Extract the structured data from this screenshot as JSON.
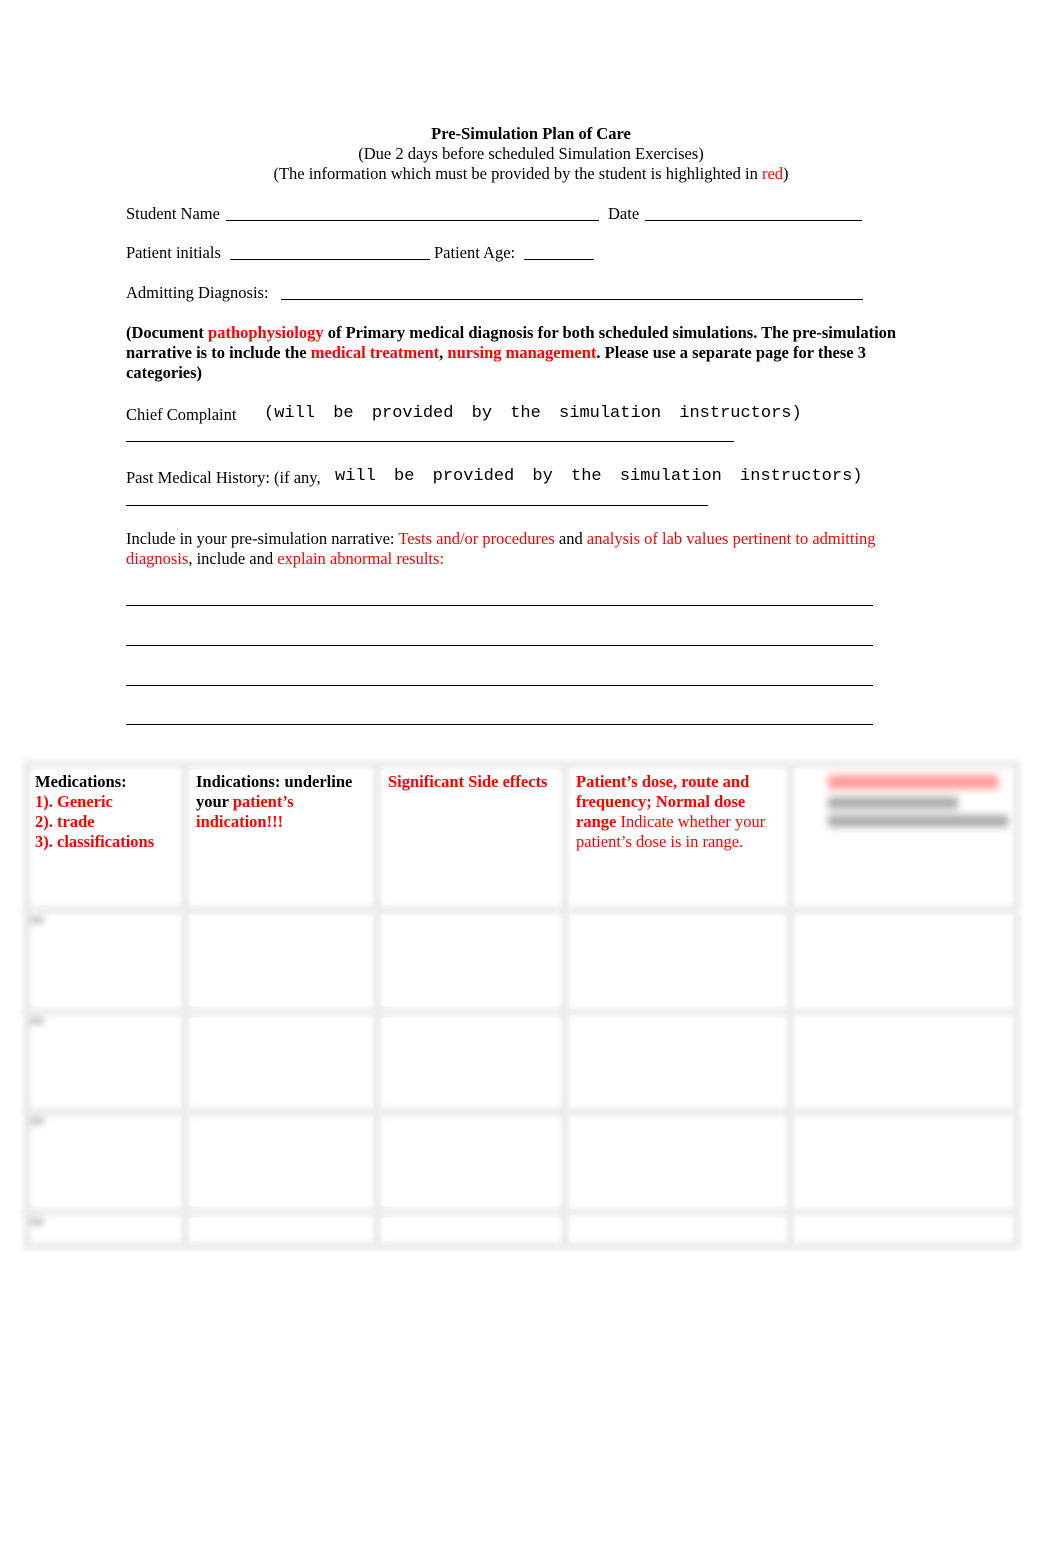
{
  "header": {
    "title": "Pre-Simulation Plan of Care",
    "subtitle": "(Due 2 days before scheduled Simulation Exercises)",
    "note_prefix": "(The information which must be provided by the student is highlighted in ",
    "note_red": "red",
    "note_suffix": ")"
  },
  "fields": {
    "student_name_label": "Student Name",
    "date_label": "Date",
    "patient_initials_label": "Patient initials",
    "patient_age_label": "Patient Age:",
    "admitting_diagnosis_label": "Admitting Diagnosis:"
  },
  "instructions": {
    "part1": "(Document ",
    "red1": "pathophysiology",
    "part2": " of Primary medical diagnosis for both scheduled simulations. The pre-simulation narrative is to include the ",
    "red2": "medical treatment",
    "part3": ", ",
    "red3": "nursing management",
    "part4": ". Please use a separate page for these 3 categories)"
  },
  "chief_complaint": {
    "label": "Chief Complaint",
    "note": "(will be provided by the simulation instructors)"
  },
  "past_medical_history": {
    "label": "Past Medical History: (if any,",
    "note": "will be provided by the simulation instructors)"
  },
  "narrative": {
    "prefix": "Include in your pre-simulation narrative: ",
    "red1": "Tests and/or procedures",
    "mid1": " and ",
    "red2": "analysis of lab values pertinent to admitting diagnosis",
    "mid2": ", include and ",
    "red3": "explain abnormal results:"
  },
  "med_table": {
    "col1": {
      "title": "Medications:",
      "items": [
        "1). Generic",
        "2). trade",
        "3). classifications"
      ]
    },
    "col2": {
      "title_black": "Indications: underline your ",
      "title_red": "patient’s indication!!!"
    },
    "col3": {
      "title": "Significant Side effects"
    },
    "col4": {
      "title_bold": "Patient’s dose, route and frequency; Normal dose range",
      "title_regular": " Indicate whether your patient’s dose is in range."
    },
    "col5": {
      "title": ""
    },
    "row_count": 4
  }
}
